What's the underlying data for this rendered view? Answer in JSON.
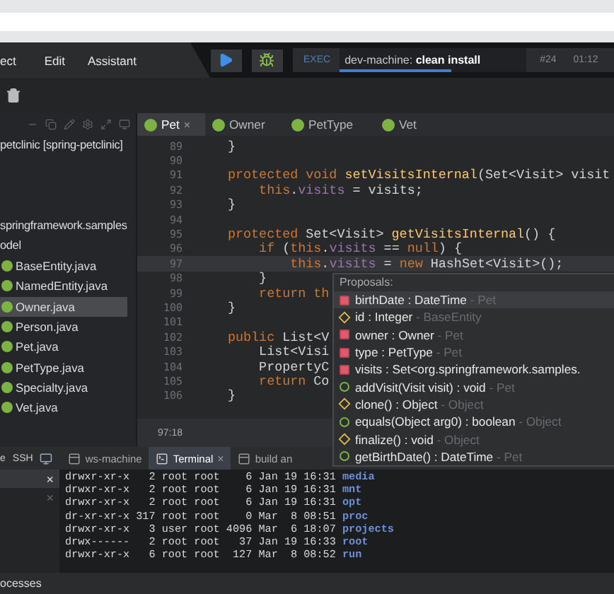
{
  "menu": [
    "ect",
    "Edit",
    "Assistant"
  ],
  "run_bar": {
    "exec_label": "EXEC",
    "command": "dev-machine: **clean install**",
    "level": 0.6,
    "build": "#24",
    "time": "01:12"
  },
  "project": {
    "root": "petclinic [spring-petclinic]",
    "package": "springframework.samples",
    "folder": "odel",
    "files": [
      {
        "name": "BaseEntity.java",
        "selected": false
      },
      {
        "name": "NamedEntity.java",
        "selected": false
      },
      {
        "name": "Owner.java",
        "selected": true
      },
      {
        "name": "Person.java",
        "selected": false
      },
      {
        "name": "Pet.java",
        "selected": false
      },
      {
        "name": "PetType.java",
        "selected": false
      },
      {
        "name": "Specialty.java",
        "selected": false
      },
      {
        "name": "Vet.java",
        "selected": false
      }
    ]
  },
  "editor": {
    "tabs": [
      {
        "label": "Pet",
        "close": "×",
        "selected": true
      },
      {
        "label": "Owner",
        "selected": false
      },
      {
        "label": "PetType",
        "selected": false
      },
      {
        "label": "Vet",
        "selected": false
      }
    ],
    "lines": [
      {
        "number": "89",
        "current": false,
        "tokens": [
          {
            "kind": "plain",
            "text": "}"
          }
        ]
      },
      {
        "number": "90",
        "current": false
      },
      {
        "number": "91",
        "current": false,
        "tokens": [
          {
            "kind": "kw",
            "text": "protected void "
          },
          {
            "kind": "fn",
            "text": "setVisitsInternal"
          },
          {
            "kind": "plain",
            "text": "(Set<Visit> visit"
          }
        ]
      },
      {
        "number": "92",
        "current": false,
        "tokens": [
          {
            "kind": "kw",
            "text": "    this"
          },
          {
            "kind": "plain",
            "text": "."
          },
          {
            "kind": "field",
            "text": "visits"
          },
          {
            "kind": "plain",
            "text": " = visits;"
          }
        ]
      },
      {
        "number": "93",
        "current": false,
        "tokens": [
          {
            "kind": "plain",
            "text": "}"
          }
        ]
      },
      {
        "number": "94",
        "current": false
      },
      {
        "number": "95",
        "current": false,
        "tokens": [
          {
            "kind": "kw",
            "text": "protected "
          },
          {
            "kind": "plain",
            "text": "Set<Visit> "
          },
          {
            "kind": "fn",
            "text": "getVisitsInternal"
          },
          {
            "kind": "plain",
            "text": "() {"
          }
        ]
      },
      {
        "number": "96",
        "current": false,
        "tokens": [
          {
            "kind": "kw",
            "text": "    if "
          },
          {
            "kind": "plain",
            "text": "("
          },
          {
            "kind": "kw",
            "text": "this"
          },
          {
            "kind": "plain",
            "text": "."
          },
          {
            "kind": "field",
            "text": "visits"
          },
          {
            "kind": "plain",
            "text": " == "
          },
          {
            "kind": "kw",
            "text": "null"
          },
          {
            "kind": "plain",
            "text": ") {"
          }
        ]
      },
      {
        "number": "97",
        "current": true,
        "tokens": [
          {
            "kind": "kw",
            "text": "        this"
          },
          {
            "kind": "plain",
            "text": "."
          },
          {
            "kind": "field",
            "text": "visits"
          },
          {
            "kind": "plain",
            "text": " = "
          },
          {
            "kind": "kw",
            "text": "new "
          },
          {
            "kind": "plain",
            "text": "HashSet<Visit>();"
          }
        ]
      },
      {
        "number": "98",
        "current": false,
        "tokens": [
          {
            "kind": "plain",
            "text": "    }"
          }
        ]
      },
      {
        "number": "99",
        "current": false,
        "tokens": [
          {
            "kind": "kw",
            "text": "    return th"
          }
        ]
      },
      {
        "number": "100",
        "current": false,
        "tokens": [
          {
            "kind": "plain",
            "text": "}"
          }
        ]
      },
      {
        "number": "101",
        "current": false
      },
      {
        "number": "102",
        "current": false,
        "tokens": [
          {
            "kind": "kw",
            "text": "public "
          },
          {
            "kind": "plain",
            "text": "List<V"
          }
        ]
      },
      {
        "number": "103",
        "current": false,
        "tokens": [
          {
            "kind": "plain",
            "text": "    List<Visi"
          }
        ]
      },
      {
        "number": "104",
        "current": false,
        "tokens": [
          {
            "kind": "plain",
            "text": "    PropertyC"
          }
        ]
      },
      {
        "number": "105",
        "current": false,
        "tokens": [
          {
            "kind": "kw",
            "text": "    return "
          },
          {
            "kind": "plain",
            "text": "Co"
          }
        ]
      },
      {
        "number": "106",
        "current": false,
        "tokens": [
          {
            "kind": "plain",
            "text": "}"
          }
        ]
      }
    ],
    "cursor": "97:18"
  },
  "proposals": {
    "title": "Proposals:",
    "items": [
      {
        "kind": "field",
        "label": "birthDate : DateTime",
        "origin": " - Pet",
        "selected": true
      },
      {
        "kind": "protected",
        "label": "id : Integer",
        "origin": " - BaseEntity",
        "selected": false
      },
      {
        "kind": "field",
        "label": "owner : Owner",
        "origin": " - Pet",
        "selected": false
      },
      {
        "kind": "field",
        "label": "type : PetType",
        "origin": " - Pet",
        "selected": false
      },
      {
        "kind": "field",
        "label": "visits : Set<org.springframework.samples.",
        "selected": false
      },
      {
        "kind": "method",
        "label": "addVisit(Visit visit) : void",
        "origin": " - Pet",
        "selected": false
      },
      {
        "kind": "protected",
        "label": "clone() : Object",
        "origin": " - Object",
        "selected": false
      },
      {
        "kind": "method",
        "label": "equals(Object arg0) : boolean",
        "origin": " - Object",
        "selected": false
      },
      {
        "kind": "protected",
        "label": "finalize() : void",
        "origin": " - Object",
        "selected": false
      },
      {
        "kind": "method",
        "label": "getBirthDate() : DateTime",
        "origin": " - Pet",
        "selected": false
      }
    ]
  },
  "bottom": {
    "left_tabs": [
      "e",
      "SSH"
    ],
    "left_rows": [
      {
        "close": "×",
        "selected": true
      },
      {
        "close": "×",
        "selected": false
      }
    ],
    "tabs": [
      {
        "label": "ws-machine",
        "selected": false
      },
      {
        "label": "Terminal",
        "close": "×",
        "selected": true
      },
      {
        "label": "build an",
        "selected": false
      }
    ],
    "terminal": [
      {
        "listing": "drwxr-xr-x   2 root root    6 Jan 19 16:31",
        "name": "media"
      },
      {
        "listing": "drwxr-xr-x   2 root root    6 Jan 19 16:31",
        "name": "mnt"
      },
      {
        "listing": "drwxr-xr-x   2 root root    6 Jan 19 16:31",
        "name": "opt"
      },
      {
        "listing": "dr-xr-xr-x 317 root root    0 Mar  8 08:51",
        "name": "proc"
      },
      {
        "listing": "drwxr-xr-x   3 user root 4096 Mar  6 18:07",
        "name": "projects"
      },
      {
        "listing": "drwx------   2 root root   37 Jan 19 16:33",
        "name": "root"
      },
      {
        "listing": "drwxr-xr-x   6 root root  127 Mar  8 08:52",
        "name": "run"
      }
    ],
    "footer": "ocesses"
  }
}
